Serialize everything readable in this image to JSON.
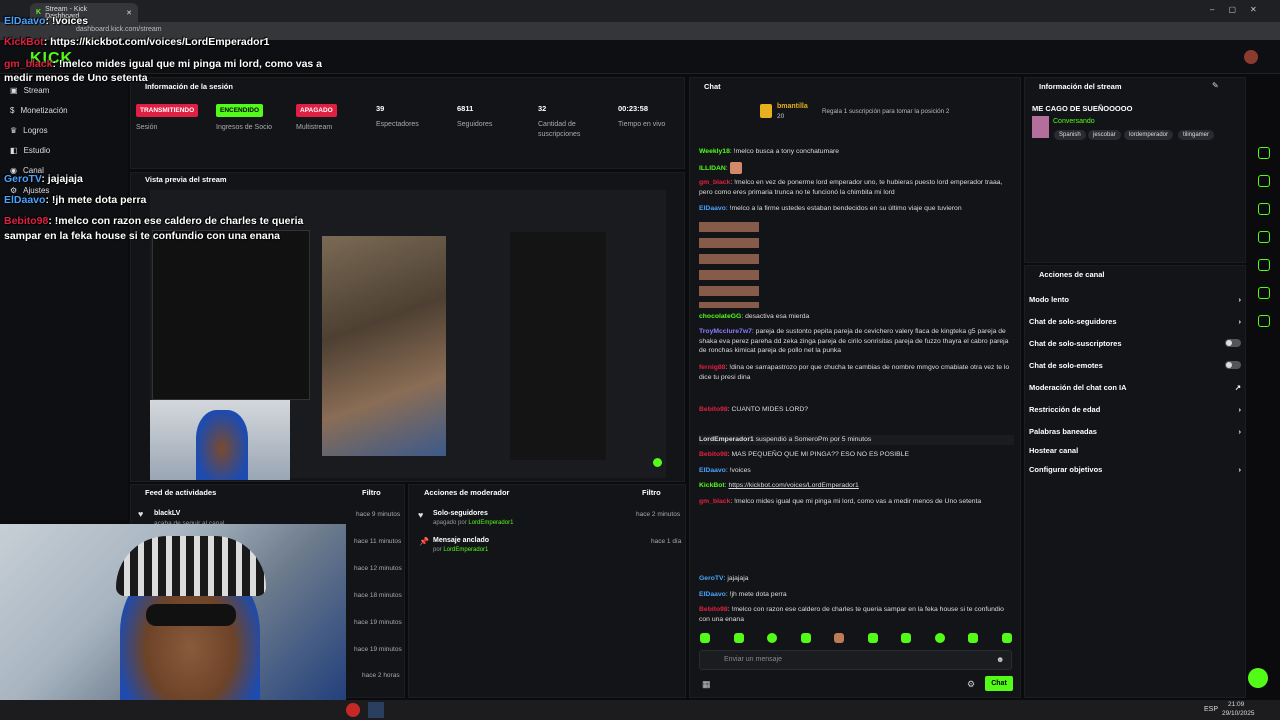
{
  "browser": {
    "tab_title": "Stream - Kick Dashboard",
    "url": "dashboard.kick.com/stream"
  },
  "sidebar": {
    "items": [
      {
        "label": "Stream",
        "icon": "stream-icon"
      },
      {
        "label": "Monetización",
        "icon": "dollar-icon"
      },
      {
        "label": "Logros",
        "icon": "trophy-icon"
      },
      {
        "label": "Estudio",
        "icon": "studio-icon"
      },
      {
        "label": "Canal",
        "icon": "channel-icon"
      },
      {
        "label": "Ajustes",
        "icon": "gear-icon"
      }
    ]
  },
  "session": {
    "title": "Información de la sesión",
    "badges": [
      {
        "label": "TRANSMITIENDO",
        "caption": "Sesión",
        "color": "#e02042"
      },
      {
        "label": "ENCENDIDO",
        "caption": "Ingresos de Socio",
        "color": "#53fc18"
      },
      {
        "label": "APAGADO",
        "caption": "Multistream",
        "color": "#e02042"
      }
    ],
    "stats": [
      {
        "value": "39",
        "label": "Espectadores"
      },
      {
        "value": "6811",
        "label": "Seguidores"
      },
      {
        "value": "32",
        "label": "Cantidad de suscripciones"
      },
      {
        "value": "00:23:58",
        "label": "Tiempo en vivo"
      }
    ]
  },
  "preview": {
    "title": "Vista previa del stream"
  },
  "feed": {
    "title": "Feed de actividades",
    "filter": "Filtro",
    "first_user": "blackLV",
    "first_action": "acaba de seguir al canal",
    "times": [
      "hace 9 minutos",
      "hace 11 minutos",
      "hace 12 minutos",
      "hace 18 minutos",
      "hace 19 minutos",
      "hace 19 minutos",
      "hace 2 horas"
    ]
  },
  "mod": {
    "title": "Acciones de moderador",
    "filter": "Filtro",
    "items": [
      {
        "title": "Solo-seguidores",
        "sub": "apagado por",
        "by": "LordEmperador1",
        "time": "hace 2 minutos"
      },
      {
        "title": "Mensaje anclado",
        "sub": "por",
        "by": "LordEmperador1",
        "time": "hace 1 día"
      }
    ]
  },
  "chat": {
    "title": "Chat",
    "top_gifter": "bmantilla",
    "top_count": "20",
    "sub_prompt": "Regala 1 suscripción para tomar la posición 2",
    "input_placeholder": "Enviar un mensaje",
    "send_label": "Chat",
    "lines": [
      {
        "user": "Weekly18",
        "color": "#53fc18",
        "msg": "!melco busca a tony conchatumare"
      },
      {
        "user": "ILLIDAN",
        "color": "#53fc18",
        "msg": ""
      },
      {
        "user": "gm_black",
        "color": "#e02042",
        "msg": "!melco en vez de ponerme lord emperador uno, te hubieras puesto lord emperador traaa, pero como eres primaria trunca no te funcionó la chimbita mi lord"
      },
      {
        "user": "ElDaavo",
        "color": "#4aa3ff",
        "msg": "!melco a la firme ustedes estaban bendecidos en su último viaje que tuvieron"
      },
      {
        "user": "chocolateGG",
        "color": "#53fc18",
        "msg": "desactiva esa mierda"
      },
      {
        "user": "TroyMcclure7w7",
        "color": "#8a7dff",
        "msg": "pareja de sustonto pepita pareja de cevichero valery flaca de kingteka g5 pareja de shaka eva perez pareha dd zeka zinga pareja de cirilo sonrisitas pareja de fuzzo thayra el cabro pareja de ronchas kimicat pareja de pollo net la punka"
      },
      {
        "user": "fernig88",
        "color": "#e02042",
        "msg": "!dina oe sarrapastrozo por que chucha te cambias de nombre mmgvo cmabiate otra vez te lo dice tu presi dina"
      },
      {
        "user": "Bebito98",
        "color": "#e02042",
        "msg": "CUANTO MIDES LORD?"
      },
      {
        "user": "LordEmperador1",
        "color": "#ddd",
        "msg": "suspendió a SomeroPm por 5 minutos"
      },
      {
        "user": "Bebito98",
        "color": "#e02042",
        "msg": "MAS PEQUEÑO QUE MI PINGA?? ESO NO ES POSIBLE"
      },
      {
        "user": "ElDaavo",
        "color": "#4aa3ff",
        "msg": "!voices"
      },
      {
        "user": "KickBot",
        "color": "#53fc18",
        "msg": "https://kickbot.com/voices/LordEmperador1"
      },
      {
        "user": "gm_black",
        "color": "#e02042",
        "msg": "!melco mides igual que mi pinga mi lord, como vas a medir menos de Uno setenta"
      },
      {
        "user": "GeroTV",
        "color": "#4aa3ff",
        "msg": "jajajaja"
      },
      {
        "user": "ElDaavo",
        "color": "#4aa3ff",
        "msg": "!jh mete dota perra"
      },
      {
        "user": "Bebito98",
        "color": "#e02042",
        "msg": "!melco con razon ese caldero de charles te queria sampar en la feka house si te confundio con una enana"
      }
    ]
  },
  "overlay": {
    "lines": [
      {
        "user": "ElDaavo",
        "color": "#4aa3ff",
        "msg": "!voices"
      },
      {
        "user": "KickBot",
        "color": "#e02042",
        "msg": "https://kickbot.com/voices/LordEmperador1"
      },
      {
        "user": "gm_black",
        "color": "#e02042",
        "msg": "!melco mides igual que mi pinga mi lord, como vas a medir menos de Uno setenta"
      },
      {
        "user": "GeroTV",
        "color": "#4aa3ff",
        "msg": "jajajaja"
      },
      {
        "user": "ElDaavo",
        "color": "#4aa3ff",
        "msg": "!jh mete dota perra"
      },
      {
        "user": "Bebito98",
        "color": "#e02042",
        "msg": "!melco con razon ese caldero de charles te queria sampar en la feka house si te confundio con una enana"
      }
    ]
  },
  "stream_info": {
    "title": "Información del stream",
    "stream_title": "ME CAGO DE SUEÑOOOOO",
    "category": "Conversando",
    "tags": [
      "Spanish",
      "jescobar",
      "lordemperador",
      "tilingamer"
    ]
  },
  "channel_actions": {
    "title": "Acciones de canal",
    "items": [
      {
        "label": "Modo lento",
        "control": "chevron"
      },
      {
        "label": "Chat de solo-seguidores",
        "control": "chevron"
      },
      {
        "label": "Chat de solo-suscriptores",
        "control": "toggle"
      },
      {
        "label": "Chat de solo-emotes",
        "control": "toggle"
      },
      {
        "label": "Moderación del chat con IA",
        "control": "external"
      },
      {
        "label": "Restricción de edad",
        "control": "chevron"
      },
      {
        "label": "Palabras baneadas",
        "control": "chevron"
      },
      {
        "label": "Hostear canal",
        "control": "none"
      },
      {
        "label": "Configurar objetivos",
        "control": "chevron"
      }
    ]
  },
  "taskbar": {
    "lang": "ESP",
    "time": "21:09",
    "date": "29/10/2025"
  },
  "colors": {
    "accent": "#53fc18",
    "live": "#e02042",
    "bg": "#0b0b0d"
  }
}
